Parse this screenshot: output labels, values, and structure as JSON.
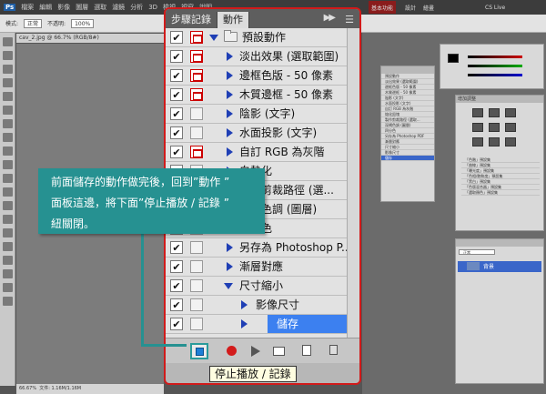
{
  "photoshop": {
    "logo": "Ps",
    "menu": [
      "檔案",
      "編輯",
      "影像",
      "圖層",
      "選取",
      "濾鏡",
      "分析",
      "3D",
      "檢視",
      "視窗",
      "說明"
    ],
    "workspace_buttons": [
      "基本功能",
      "設計",
      "繪畫"
    ],
    "cs_live": "CS Live",
    "document_tab": "cav_2.jpg @ 66.7% (RGB/8#)",
    "zoom_status": "66.67%",
    "status_text": "文件: 1.16M/1.16M",
    "option_bar": {
      "mode_label": "模式:",
      "mode_value": "正常",
      "opacity_label": "不透明:",
      "opacity_value": "100%"
    },
    "right_panel": {
      "adjustments_title": "增加調整",
      "history_items": [
        "預設動作",
        "淡出效果 (選取範圍)",
        "邊框色版 - 50 像素",
        "木質邊框 - 50 像素",
        "陰影 (文字)",
        "水面投影 (文字)",
        "自訂 RGB 為灰階",
        "熔化鉛塊",
        "製作剪裁路徑 (選取...",
        "深褐色調 (圖層)",
        "四分色",
        "另存為 Photoshop PDF",
        "漸層對應",
        "尺寸縮小",
        "影像尺寸",
        "儲存"
      ],
      "presets": [
        "「色階」預設集",
        "「曲線」預設集",
        "「曝光度」預設集",
        "「色相/飽和度」預設集",
        "「黑白」預設集",
        "「色版混合器」預設集",
        "「選取顏色」預設集"
      ],
      "layers_mode": "正常",
      "layer_name": "背景"
    }
  },
  "actions_panel": {
    "tabs": [
      "步驟記錄",
      "動作"
    ],
    "active_tab": "動作",
    "rows": [
      {
        "label": "預設動作",
        "checked": true,
        "dialog": true,
        "kind": "set",
        "expanded": true
      },
      {
        "label": "淡出效果 (選取範圍)",
        "checked": true,
        "dialog": true,
        "kind": "action"
      },
      {
        "label": "邊框色版 - 50 像素",
        "checked": true,
        "dialog": true,
        "kind": "action"
      },
      {
        "label": "木質邊框 - 50 像素",
        "checked": true,
        "dialog": true,
        "kind": "action"
      },
      {
        "label": "陰影 (文字)",
        "checked": true,
        "dialog": false,
        "kind": "action"
      },
      {
        "label": "水面投影 (文字)",
        "checked": true,
        "dialog": false,
        "kind": "action"
      },
      {
        "label": "自訂 RGB 為灰階",
        "checked": true,
        "dialog": true,
        "kind": "action"
      },
      {
        "label": "白熱化",
        "checked": true,
        "dialog": false,
        "kind": "action"
      },
      {
        "label": "製作剪裁路徑 (選...",
        "checked": true,
        "dialog": false,
        "kind": "action"
      },
      {
        "label": "深褐色調 (圖層)",
        "checked": true,
        "dialog": false,
        "kind": "action"
      },
      {
        "label": "四分色",
        "checked": true,
        "dialog": false,
        "kind": "action"
      },
      {
        "label": "另存為 Photoshop P...",
        "checked": true,
        "dialog": false,
        "kind": "action"
      },
      {
        "label": "漸層對應",
        "checked": true,
        "dialog": false,
        "kind": "action"
      },
      {
        "label": "尺寸縮小",
        "checked": true,
        "dialog": false,
        "kind": "action",
        "expanded": true
      },
      {
        "label": "影像尺寸",
        "checked": true,
        "dialog": false,
        "kind": "step"
      },
      {
        "label": "儲存",
        "checked": true,
        "dialog": false,
        "kind": "step",
        "selected": true
      }
    ],
    "tooltip": "停止播放 / 記錄"
  },
  "callout": {
    "lines": [
      "前面儲存的動作做完後，回到”動作 ”",
      "面板這邊，將下面”停止播放 / 記錄 ”",
      "紐關閉。"
    ]
  },
  "colors": {
    "callout": "#269191",
    "highlight_border": "#d11a1a",
    "selection": "#3c80f0",
    "record": "#d31b1b"
  }
}
